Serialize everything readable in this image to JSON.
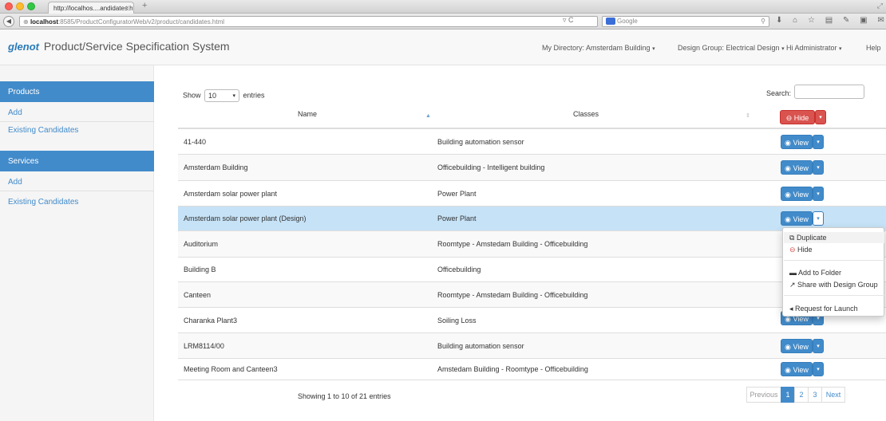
{
  "browser": {
    "tab_title": "http://localhos....andidates.html",
    "tab_close": "×",
    "new_tab": "+",
    "url_host": "localhost",
    "url_rest": ":8585/ProductConfiguratorWeb/v2/product/candidates.html",
    "search_placeholder": "Google",
    "reload": "▿ C"
  },
  "header": {
    "logo": "glenot",
    "title": "Product/Service Specification System",
    "directory": "My Directory: Amsterdam Building",
    "design_group": "Design Group: Electrical Design",
    "user": "Hi Administrator",
    "help": "Help"
  },
  "sidebar": {
    "products_heading": "Products",
    "products_add": "Add",
    "products_existing": "Existing Candidates",
    "services_heading": "Services",
    "services_add": "Add",
    "services_existing": "Existing Candidates"
  },
  "table": {
    "show_label": "Show",
    "show_value": "10",
    "entries_label": "entries",
    "search_label": "Search:",
    "col_name": "Name",
    "col_classes": "Classes",
    "header_hide_label": "Hide",
    "view_label": "View",
    "rows": [
      {
        "name": "41-440",
        "classes": "Building automation sensor"
      },
      {
        "name": "Amsterdam Building",
        "classes": "Officebuilding - Intelligent building"
      },
      {
        "name": "Amsterdam solar power plant",
        "classes": "Power Plant"
      },
      {
        "name": "Amsterdam solar power plant (Design)",
        "classes": "Power Plant"
      },
      {
        "name": "Auditorium",
        "classes": "Roomtype - Amstedam Building - Officebuilding"
      },
      {
        "name": "Building B",
        "classes": "Officebuilding"
      },
      {
        "name": "Canteen",
        "classes": "Roomtype - Amstedam Building - Officebuilding"
      },
      {
        "name": "Charanka Plant3",
        "classes": "Soiling Loss"
      },
      {
        "name": "LRM8114/00",
        "classes": "Building automation sensor"
      },
      {
        "name": "Meeting Room and Canteen3",
        "classes": "Amstedam Building - Roomtype - Officebuilding"
      }
    ],
    "info": "Showing 1 to 10 of 21 entries"
  },
  "dropdown": {
    "duplicate": "Duplicate",
    "hide": "Hide",
    "add_to_folder": "Add to Folder",
    "share": "Share with Design Group",
    "request_launch": "Request for Launch"
  },
  "pagination": {
    "previous": "Previous",
    "p1": "1",
    "p2": "2",
    "p3": "3",
    "next": "Next"
  },
  "colors": {
    "primary": "#428bca",
    "danger": "#d9534f",
    "row_highlight": "#c6e2f6"
  }
}
